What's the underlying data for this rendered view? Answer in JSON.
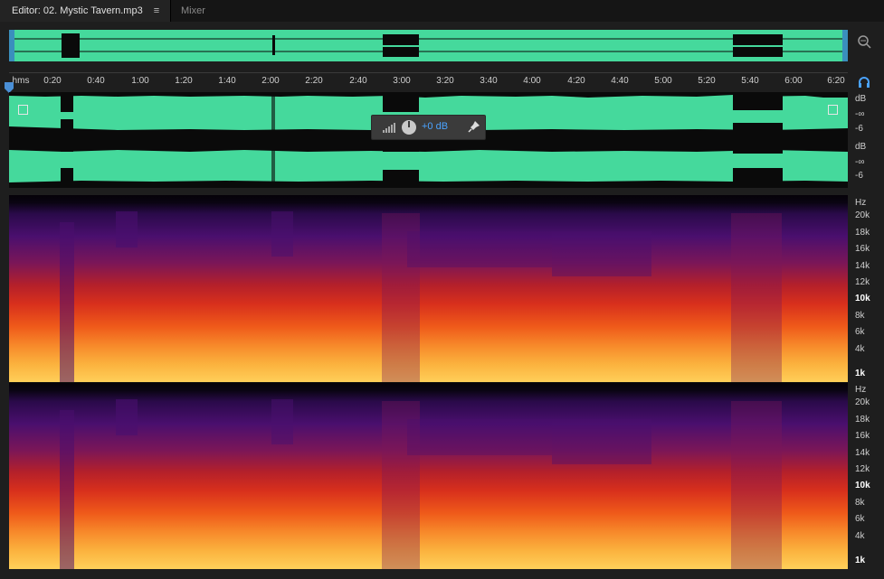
{
  "tabs": {
    "editor": "Editor: 02. Mystic Tavern.mp3",
    "menu": "≡",
    "mixer": "Mixer"
  },
  "ruler": {
    "labels": [
      "hms",
      "0:20",
      "0:40",
      "1:00",
      "1:20",
      "1:40",
      "2:00",
      "2:20",
      "2:40",
      "3:00",
      "3:20",
      "3:40",
      "4:00",
      "4:20",
      "4:40",
      "5:00",
      "5:20",
      "5:40",
      "6:00",
      "6:20"
    ]
  },
  "hud": {
    "value": "+0 dB"
  },
  "db_scale": {
    "ch1": [
      "dB",
      "-∞",
      "-6"
    ],
    "ch2": [
      "dB",
      "-∞",
      "-6"
    ]
  },
  "hz_scale": {
    "ch1": [
      "Hz",
      "20k",
      "18k",
      "16k",
      "14k",
      "12k",
      "10k",
      "8k",
      "6k",
      "4k",
      "1k"
    ],
    "ch2": [
      "Hz",
      "20k",
      "18k",
      "16k",
      "14k",
      "12k",
      "10k",
      "8k",
      "6k",
      "4k",
      "1k"
    ]
  },
  "colors": {
    "waveform": "#45d99c",
    "accent": "#4aa3ff",
    "background": "#1e1e1e"
  }
}
